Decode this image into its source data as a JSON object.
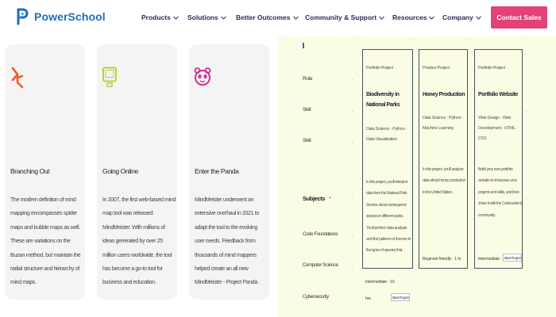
{
  "header": {
    "logo_text": "PowerSchool",
    "nav": [
      {
        "label": "Products"
      },
      {
        "label": "Solutions"
      },
      {
        "label": "Better Outcomes"
      },
      {
        "label": "Community & Support"
      },
      {
        "label": "Resources"
      },
      {
        "label": "Company"
      }
    ],
    "contact_label": "Contact Sales"
  },
  "cards": [
    {
      "icon": "branching-icon",
      "title": "Branching Out",
      "body": "The modern definition of mind mapping encompasses spider maps and bubble maps as well. These are variations on the Buzan method, but maintain the radial structure and hierarchy of mind maps."
    },
    {
      "icon": "computer-icon",
      "title": "Going Online",
      "body": "In 2007, the first web-based mind map tool was released: MindMeister. With millions of ideas generated by over 25 million users worldwide, the tool has become a go-to tool for business and education."
    },
    {
      "icon": "panda-icon",
      "title": "Enter the Panda",
      "body": "MindMeister underwent an extensive overhaul in 2021 to adapt the tool to the evolving user needs. Feedback from thousands of mind mappers helped create an all new MindMeister - Project Panda."
    }
  ],
  "filters": {
    "labels": [
      "Role",
      "Skill",
      "Skill"
    ],
    "subjects_label": "Subjects",
    "subjects": [
      "Code Foundations",
      "Computer Science",
      "Cybersecurity"
    ]
  },
  "projects": [
    {
      "kind": "Portfolio Project",
      "title": "Biodiversity in National Parks",
      "skills": "Data Science · Python · Data Visualization",
      "description": "In this project, you'll interpret data from the National Park Service about endangered species in different parks. You'll perform data analysis and find patterns or themes to the types of species that become endangered. Also, you'll create presentations and visualizations, and present your findings to the rest of the community.",
      "meta": "Intermediate · 12 hrs",
      "start_label": "Start Project"
    },
    {
      "kind": "Practice Project",
      "title": "Honey Production",
      "skills": "Data Science · Python · Machine Learning",
      "description": "In this project, you'll analyze data about honey production in the United States.",
      "meta": "Beginner friendly · 1 hr",
      "start_label": "Start Project"
    },
    {
      "kind": "Portfolio Project",
      "title": "Portfolio Website",
      "skills": "Web Design · Web Development · HTML · CSS",
      "description": "Build your own portfolio website to showcase your projects and skills, and then share it with the Codecademy community.",
      "meta": "Intermediate · 5 hrs",
      "start_label": "Start Project"
    }
  ],
  "extra_meta": {
    "level": "Intermediate · 10",
    "hours": "hrs",
    "start_label": "Start Project"
  },
  "colors": {
    "brand_blue": "#1e6fc0",
    "contact_bg": "#e2417a",
    "panel_bg": "#fbfce4",
    "branching_orange": "#f05a22",
    "computer_green": "#b9d334",
    "panda_magenta": "#cc2f9b"
  }
}
